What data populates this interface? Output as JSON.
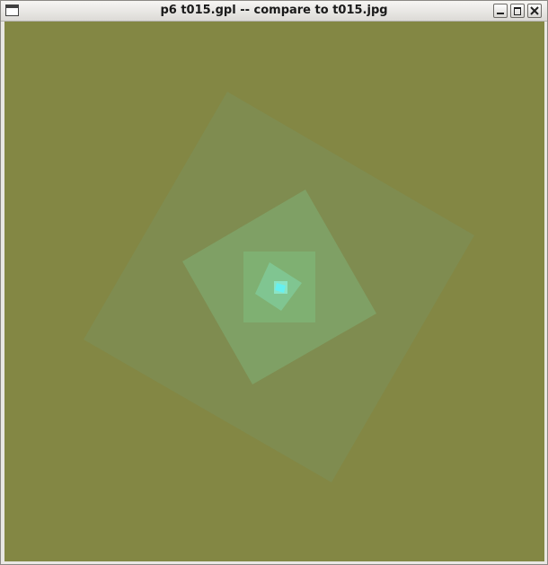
{
  "window": {
    "title": "p6 t015.gpl -- compare to t015.jpg"
  },
  "colors": {
    "background": "#838744",
    "square_1": "#7f8c50",
    "square_2": "#7fa065",
    "square_3": "#7fb072",
    "square_4": "#80c591",
    "square_5": "#8ae4c5",
    "square_6": "#66f0f0"
  },
  "icons": {
    "system_menu": "window-menu-icon",
    "minimize": "minimize-icon",
    "maximize": "maximize-icon",
    "close": "close-icon"
  }
}
